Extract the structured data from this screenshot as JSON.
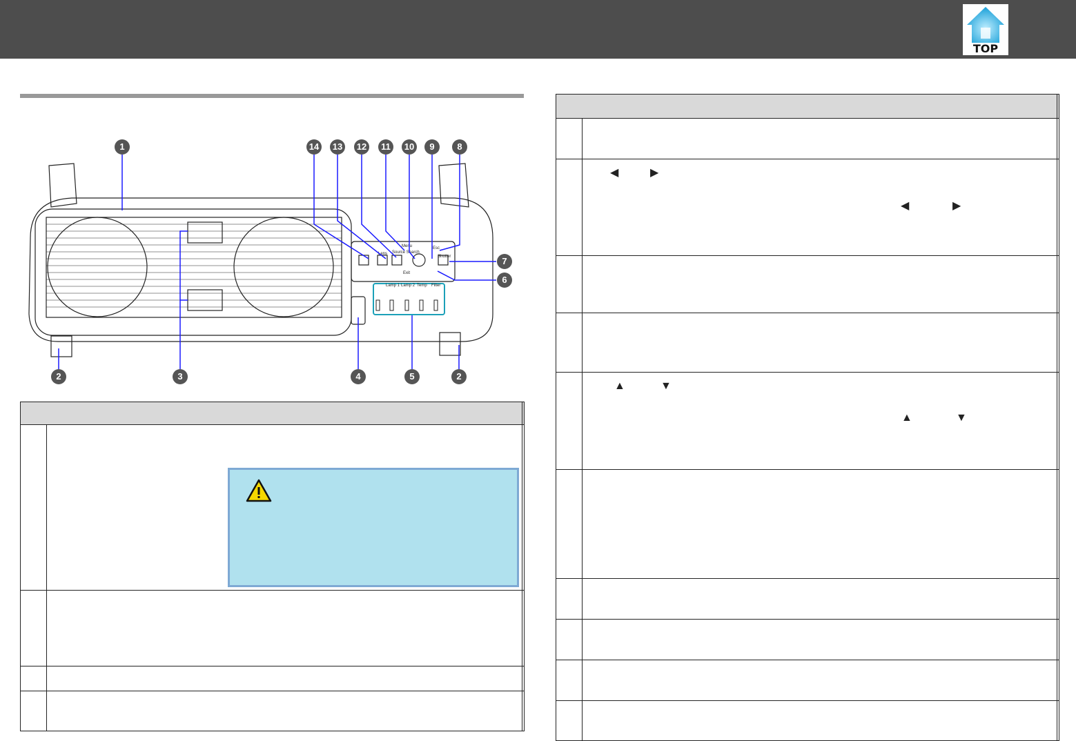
{
  "header": {
    "top_link": "TOP"
  },
  "diagram": {
    "callouts": [
      "1",
      "2",
      "3",
      "4",
      "5",
      "6",
      "7",
      "8",
      "9",
      "10",
      "11",
      "12",
      "13",
      "14"
    ],
    "panel_labels": {
      "lens": "Lens",
      "source_search": "Source Search",
      "menu": "Menu",
      "esc": "Esc",
      "shutter": "Shutter",
      "exit": "Exit"
    },
    "indicator_labels": [
      "Lamp 1",
      "Lamp 2",
      "Temp",
      "Filter"
    ]
  },
  "left_table": {
    "rows": 4
  },
  "right_table": {
    "rows": 10
  }
}
